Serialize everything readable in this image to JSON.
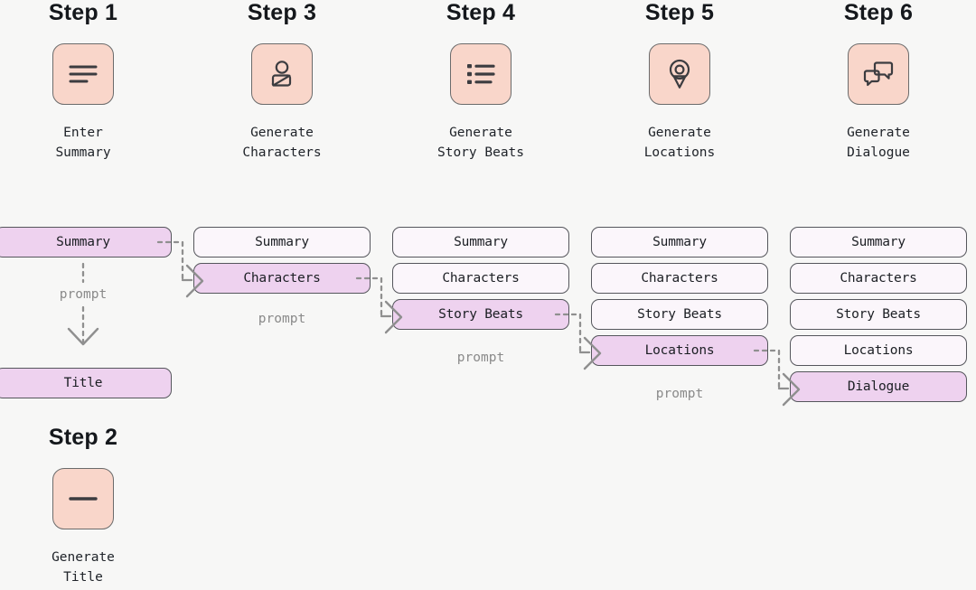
{
  "background": "#f7f7f6",
  "colors": {
    "tile_fill": "#f9d6ca",
    "chip_fill": "#fbf6fb",
    "chip_highlight": "#eed2ef",
    "stroke": "#55565c",
    "prompt_text": "#8a8a8a"
  },
  "prompt_label": "prompt",
  "columns": [
    {
      "step_title": "Step 1",
      "icon": "lines-icon",
      "caption": "Enter\nSummary",
      "chips": [
        {
          "label": "Summary",
          "highlighted": true
        },
        {
          "label": "Title",
          "highlighted": true
        }
      ]
    },
    {
      "step_title": "Step 3",
      "icon": "person-icon",
      "caption": "Generate\nCharacters",
      "chips": [
        {
          "label": "Summary",
          "highlighted": false
        },
        {
          "label": "Characters",
          "highlighted": true
        }
      ]
    },
    {
      "step_title": "Step 4",
      "icon": "bullet-list-icon",
      "caption": "Generate\nStory Beats",
      "chips": [
        {
          "label": "Summary",
          "highlighted": false
        },
        {
          "label": "Characters",
          "highlighted": false
        },
        {
          "label": "Story Beats",
          "highlighted": true
        }
      ]
    },
    {
      "step_title": "Step 5",
      "icon": "map-pin-icon",
      "caption": "Generate\nLocations",
      "chips": [
        {
          "label": "Summary",
          "highlighted": false
        },
        {
          "label": "Characters",
          "highlighted": false
        },
        {
          "label": "Story Beats",
          "highlighted": false
        },
        {
          "label": "Locations",
          "highlighted": true
        }
      ]
    },
    {
      "step_title": "Step 6",
      "icon": "chat-bubbles-icon",
      "caption": "Generate\nDialogue",
      "chips": [
        {
          "label": "Summary",
          "highlighted": false
        },
        {
          "label": "Characters",
          "highlighted": false
        },
        {
          "label": "Story Beats",
          "highlighted": false
        },
        {
          "label": "Locations",
          "highlighted": false
        },
        {
          "label": "Dialogue",
          "highlighted": true
        }
      ]
    }
  ],
  "step_two": {
    "step_title": "Step 2",
    "icon": "title-bar-icon",
    "caption": "Generate\nTitle"
  }
}
